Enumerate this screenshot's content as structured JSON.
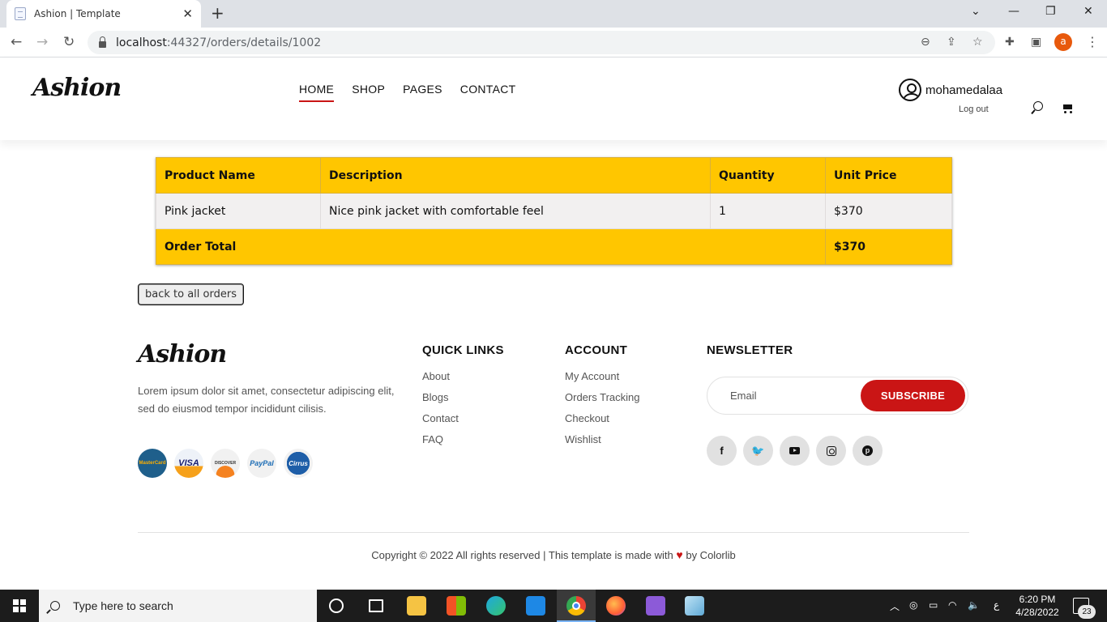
{
  "browser": {
    "tab_title": "Ashion | Template",
    "url_host": "localhost",
    "url_rest": ":44327/orders/details/1002",
    "profile_initial": "a"
  },
  "header": {
    "logo": "Ashion",
    "nav": [
      "HOME",
      "SHOP",
      "PAGES",
      "CONTACT"
    ],
    "active_nav": "HOME",
    "username": "mohamedalaa",
    "logout": "Log out"
  },
  "order": {
    "columns": [
      "Product Name",
      "Description",
      "Quantity",
      "Unit Price"
    ],
    "rows": [
      {
        "product": "Pink jacket",
        "description": "Nice pink jacket with comfortable feel",
        "quantity": "1",
        "price": "$370"
      }
    ],
    "total_label": "Order Total",
    "total_value": "$370",
    "back_button": "back to all orders"
  },
  "footer": {
    "logo": "Ashion",
    "about": "Lorem ipsum dolor sit amet, consectetur adipiscing elit, sed do eiusmod tempor incididunt cilisis.",
    "payments": [
      "MasterCard",
      "VISA",
      "DISCOVER",
      "PayPal",
      "Cirrus"
    ],
    "quick_links_title": "QUICK LINKS",
    "quick_links": [
      "About",
      "Blogs",
      "Contact",
      "FAQ"
    ],
    "account_title": "ACCOUNT",
    "account_links": [
      "My Account",
      "Orders Tracking",
      "Checkout",
      "Wishlist"
    ],
    "newsletter_title": "NEWSLETTER",
    "email_placeholder": "Email",
    "subscribe": "SUBSCRIBE",
    "socials": [
      "facebook-icon",
      "twitter-icon",
      "youtube-icon",
      "instagram-icon",
      "pinterest-icon"
    ],
    "copyright_before": "Copyright © 2022 All rights reserved | This template is made with",
    "copyright_after": "by Colorlib"
  },
  "taskbar": {
    "search_placeholder": "Type here to search",
    "time": "6:20 PM",
    "date": "4/28/2022",
    "language": "ع",
    "notifications": "23"
  },
  "colors": {
    "accent": "#ca1515",
    "table_yellow": "#ffc600"
  }
}
